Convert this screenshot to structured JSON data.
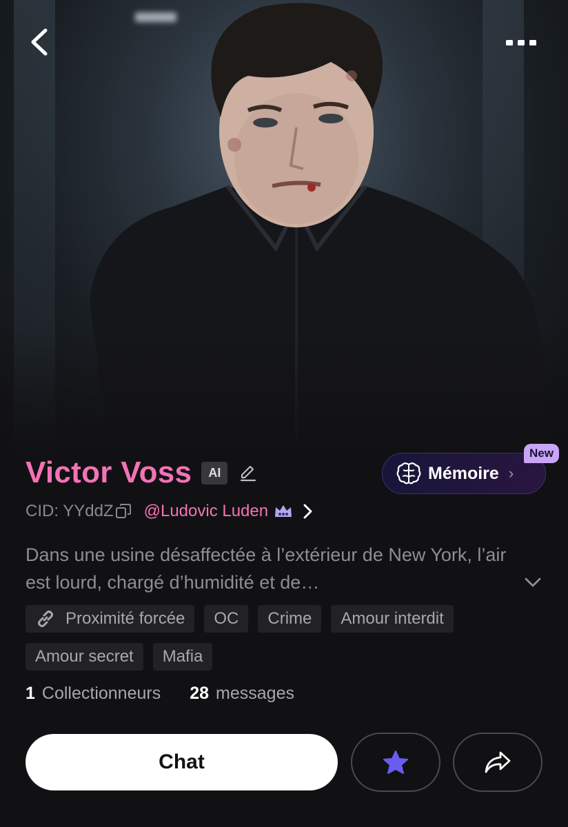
{
  "character": {
    "name": "Victor Voss",
    "ai_badge": "AI",
    "cid": "CID: YYddZ",
    "creator": "@Ludovic Luden",
    "description": "Dans une usine désaffectée à l’extérieur de New York, l’air est lourd, chargé d’humidité et de…"
  },
  "memoire": {
    "label": "Mémoire",
    "new_badge": "New",
    "icon": "brain-icon"
  },
  "tags": [
    "Proximité forcée",
    "OC",
    "Crime",
    "Amour interdit",
    "Amour secret",
    "Mafia"
  ],
  "stats": {
    "collectors_count": "1",
    "collectors_label": "Collectionneurs",
    "messages_count": "28",
    "messages_label": "messages"
  },
  "actions": {
    "chat_label": "Chat",
    "favorite_icon": "star-icon",
    "share_icon": "share-icon"
  },
  "colors": {
    "accent_pink": "#f472b6",
    "star_purple": "#6b5cf0",
    "background": "#111113"
  }
}
